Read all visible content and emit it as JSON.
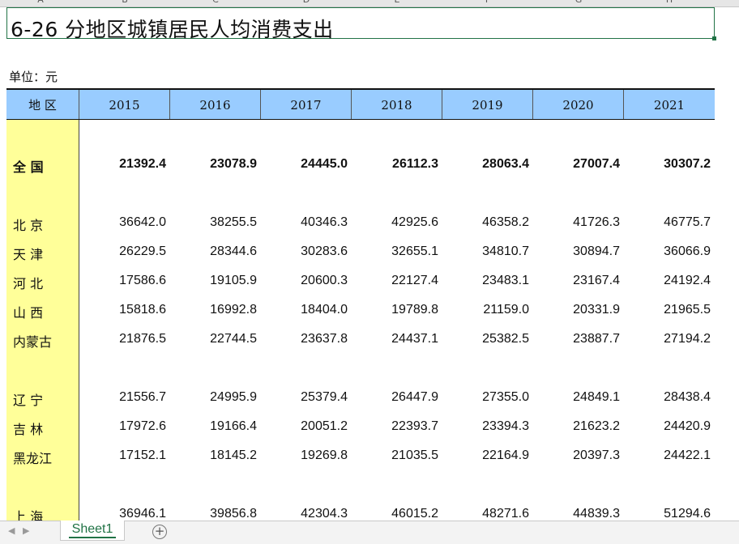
{
  "column_headers": [
    "A",
    "B",
    "C",
    "D",
    "E",
    "F",
    "G",
    "H"
  ],
  "title": "6-26   分地区城镇居民人均消费支出",
  "unit": "单位：元",
  "table": {
    "region_header": "地 区",
    "years": [
      "2015",
      "2016",
      "2017",
      "2018",
      "2019",
      "2020",
      "2021"
    ],
    "rows": [
      {
        "region": "全 国",
        "values": [
          "21392.4",
          "23078.9",
          "24445.0",
          "26112.3",
          "28063.4",
          "27007.4",
          "30307.2"
        ],
        "bold": true
      },
      {
        "region": "北 京",
        "values": [
          "36642.0",
          "38255.5",
          "40346.3",
          "42925.6",
          "46358.2",
          "41726.3",
          "46775.7"
        ]
      },
      {
        "region": "天 津",
        "values": [
          "26229.5",
          "28344.6",
          "30283.6",
          "32655.1",
          "34810.7",
          "30894.7",
          "36066.9"
        ]
      },
      {
        "region": "河 北",
        "values": [
          "17586.6",
          "19105.9",
          "20600.3",
          "22127.4",
          "23483.1",
          "23167.4",
          "24192.4"
        ]
      },
      {
        "region": "山 西",
        "values": [
          "15818.6",
          "16992.8",
          "18404.0",
          "19789.8",
          "21159.0",
          "20331.9",
          "21965.5"
        ]
      },
      {
        "region": "内蒙古",
        "values": [
          "21876.5",
          "22744.5",
          "23637.8",
          "24437.1",
          "25382.5",
          "23887.7",
          "27194.2"
        ]
      },
      {
        "region": "辽 宁",
        "values": [
          "21556.7",
          "24995.9",
          "25379.4",
          "26447.9",
          "27355.0",
          "24849.1",
          "28438.4"
        ]
      },
      {
        "region": "吉 林",
        "values": [
          "17972.6",
          "19166.4",
          "20051.2",
          "22393.7",
          "23394.3",
          "21623.2",
          "24420.9"
        ]
      },
      {
        "region": "黑龙江",
        "values": [
          "17152.1",
          "18145.2",
          "19269.8",
          "21035.5",
          "22164.9",
          "20397.3",
          "24422.1"
        ]
      },
      {
        "region": "上 海",
        "values": [
          "36946.1",
          "39856.8",
          "42304.3",
          "46015.2",
          "48271.6",
          "44839.3",
          "51294.6"
        ]
      }
    ]
  },
  "sheet_tabs": [
    "Sheet1"
  ],
  "icons": {
    "add_sheet": "plus-circle-icon",
    "scroll_left": "triangle-left-icon",
    "scroll_right": "triangle-right-icon"
  },
  "colors": {
    "header_bg": "#99ccff",
    "region_bg": "#ffff99",
    "accent": "#217346"
  }
}
